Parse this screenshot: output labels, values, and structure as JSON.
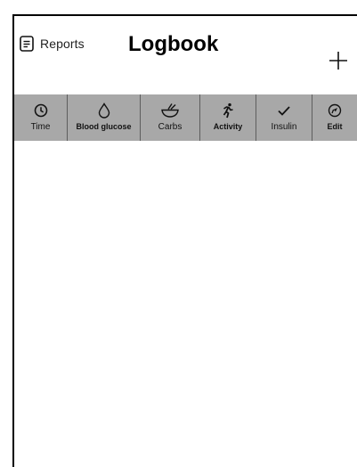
{
  "header": {
    "reports_label": "Reports",
    "title": "Logbook",
    "reports_icon": "report-document-icon",
    "add_icon": "plus-icon"
  },
  "toolbar": {
    "background": "#a8a8a8",
    "items": [
      {
        "label": "Time",
        "icon": "clock-icon"
      },
      {
        "label": "Blood glucose",
        "icon": "droplet-icon"
      },
      {
        "label": "Carbs",
        "icon": "bowl-icon"
      },
      {
        "label": "Activity",
        "icon": "running-person-icon"
      },
      {
        "label": "Insulin",
        "icon": "checkmark-icon"
      },
      {
        "label": "Edit",
        "icon": "compass-edit-icon"
      }
    ]
  }
}
